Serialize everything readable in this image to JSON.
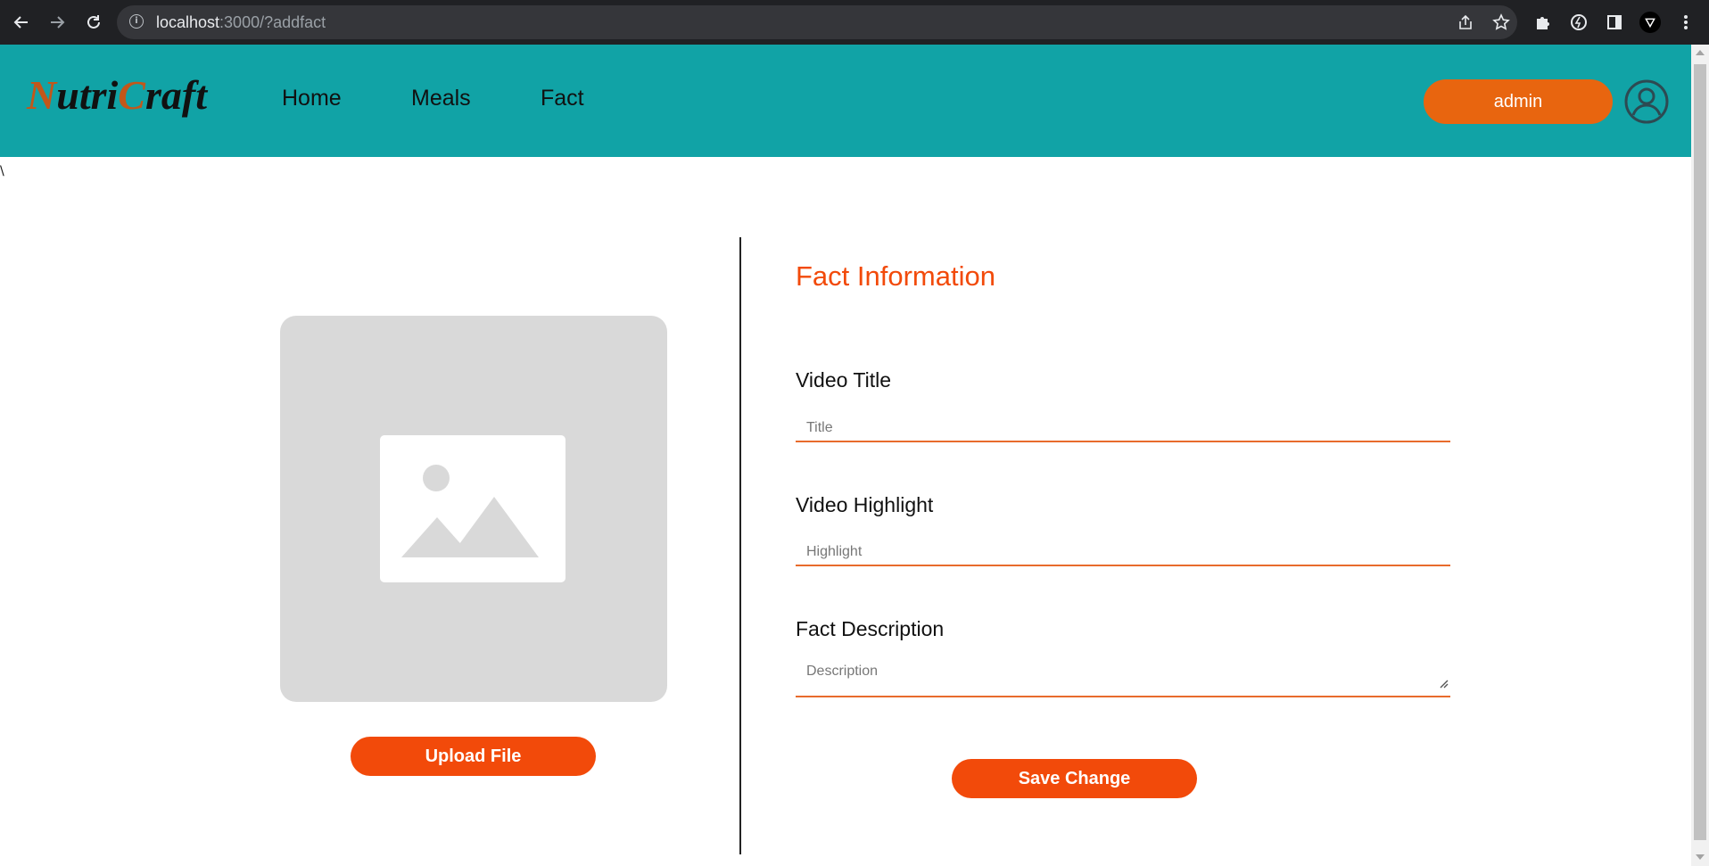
{
  "browser": {
    "url_host": "localhost",
    "url_rest": ":3000/?addfact",
    "icons": [
      "back-arrow-icon",
      "forward-arrow-icon",
      "reload-icon",
      "info-icon",
      "share-icon",
      "star-icon",
      "puzzle-icon",
      "extension-icon",
      "sidepanel-icon",
      "profile-icon",
      "menu-icon"
    ]
  },
  "header": {
    "logo_prefix": "N",
    "logo_mid1": "utri",
    "logo_accent2": "C",
    "logo_suffix": "raft",
    "nav": [
      {
        "label": "Home"
      },
      {
        "label": "Meals"
      },
      {
        "label": "Fact"
      }
    ],
    "admin_label": "admin",
    "brand_color": "#11a3a6",
    "accent_color": "#e8650f"
  },
  "stray_text": "\\",
  "left_panel": {
    "image_icon": "image-placeholder-icon",
    "upload_label": "Upload File"
  },
  "form": {
    "title": "Fact Information",
    "fields": [
      {
        "label": "Video Title",
        "placeholder": "Title"
      },
      {
        "label": "Video Highlight",
        "placeholder": "Highlight"
      },
      {
        "label": "Fact Description",
        "placeholder": "Description"
      }
    ],
    "save_label": "Save Change",
    "button_color": "#f24a0a"
  }
}
